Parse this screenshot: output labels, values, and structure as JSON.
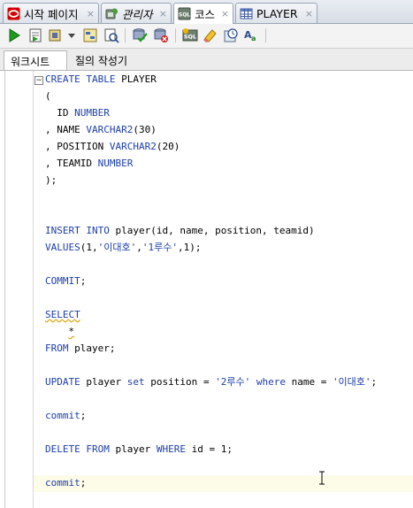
{
  "tabs": [
    {
      "label": "시작 페이지",
      "icon": "oracle-start-icon",
      "active": false
    },
    {
      "label": "관리자",
      "icon": "connection-icon",
      "active": false
    },
    {
      "label": "코스",
      "icon": "sql-worksheet-icon",
      "active": true
    },
    {
      "label": "PLAYER",
      "icon": "table-icon",
      "active": false
    }
  ],
  "close_glyph": "×",
  "toolbar": {
    "icons": [
      "run-statement-icon",
      "run-script-icon",
      "autotrace-icon",
      "dropdown-arrow-icon",
      "explain-plan-icon",
      "sql-tuning-icon",
      "commit-icon",
      "rollback-icon",
      "unshared-sql-icon",
      "clear-icon",
      "history-icon",
      "format-icon"
    ]
  },
  "subtabs": [
    {
      "label": "워크시트",
      "active": true
    },
    {
      "label": "질의 작성기",
      "active": false
    }
  ],
  "editor": {
    "fold_glyph": "−",
    "lines": [
      {
        "tokens": [
          {
            "t": "CREATE TABLE",
            "c": "kw"
          },
          {
            "t": " PLAYER",
            "c": ""
          }
        ]
      },
      {
        "tokens": [
          {
            "t": "(",
            "c": ""
          }
        ]
      },
      {
        "tokens": [
          {
            "t": "  ID",
            "c": ""
          },
          {
            "t": " NUMBER",
            "c": "kw"
          }
        ]
      },
      {
        "tokens": [
          {
            "t": ", NAME",
            "c": ""
          },
          {
            "t": " VARCHAR2",
            "c": "kw"
          },
          {
            "t": "(30)",
            "c": ""
          }
        ]
      },
      {
        "tokens": [
          {
            "t": ", POSITION",
            "c": ""
          },
          {
            "t": " VARCHAR2",
            "c": "kw"
          },
          {
            "t": "(20)",
            "c": ""
          }
        ]
      },
      {
        "tokens": [
          {
            "t": ", TEAMID",
            "c": ""
          },
          {
            "t": " NUMBER",
            "c": "kw"
          }
        ]
      },
      {
        "tokens": [
          {
            "t": ");",
            "c": ""
          }
        ]
      },
      {
        "tokens": []
      },
      {
        "tokens": []
      },
      {
        "tokens": [
          {
            "t": "INSERT INTO",
            "c": "kw"
          },
          {
            "t": " player(id, name, position, teamid)",
            "c": ""
          }
        ]
      },
      {
        "tokens": [
          {
            "t": "VALUES",
            "c": "kw"
          },
          {
            "t": "(1,",
            "c": ""
          },
          {
            "t": "'이대호'",
            "c": "str"
          },
          {
            "t": ",",
            "c": ""
          },
          {
            "t": "'1루수'",
            "c": "str"
          },
          {
            "t": ",1);",
            "c": ""
          }
        ]
      },
      {
        "tokens": []
      },
      {
        "tokens": [
          {
            "t": "COMMIT",
            "c": "kw"
          },
          {
            "t": ";",
            "c": ""
          }
        ]
      },
      {
        "tokens": []
      },
      {
        "tokens": [
          {
            "t": "SELECT",
            "c": "kw sq"
          }
        ]
      },
      {
        "tokens": [
          {
            "t": "    ",
            "c": ""
          },
          {
            "t": "*",
            "c": "sq"
          }
        ]
      },
      {
        "tokens": [
          {
            "t": "FROM",
            "c": "kw"
          },
          {
            "t": " player;",
            "c": ""
          }
        ]
      },
      {
        "tokens": []
      },
      {
        "tokens": [
          {
            "t": "UPDATE",
            "c": "kw"
          },
          {
            "t": " player ",
            "c": ""
          },
          {
            "t": "set",
            "c": "kw"
          },
          {
            "t": " position = ",
            "c": ""
          },
          {
            "t": "'2루수'",
            "c": "str"
          },
          {
            "t": " ",
            "c": ""
          },
          {
            "t": "where",
            "c": "kw"
          },
          {
            "t": " name = ",
            "c": ""
          },
          {
            "t": "'이대호'",
            "c": "str"
          },
          {
            "t": ";",
            "c": ""
          }
        ]
      },
      {
        "tokens": []
      },
      {
        "tokens": [
          {
            "t": "commit",
            "c": "kw"
          },
          {
            "t": ";",
            "c": ""
          }
        ]
      },
      {
        "tokens": []
      },
      {
        "tokens": [
          {
            "t": "DELETE FROM",
            "c": "kw"
          },
          {
            "t": " player ",
            "c": ""
          },
          {
            "t": "WHERE",
            "c": "kw"
          },
          {
            "t": " id = 1;",
            "c": ""
          }
        ]
      },
      {
        "tokens": []
      },
      {
        "tokens": [
          {
            "t": "commit",
            "c": "kw"
          },
          {
            "t": ";",
            "c": ""
          }
        ]
      }
    ]
  }
}
